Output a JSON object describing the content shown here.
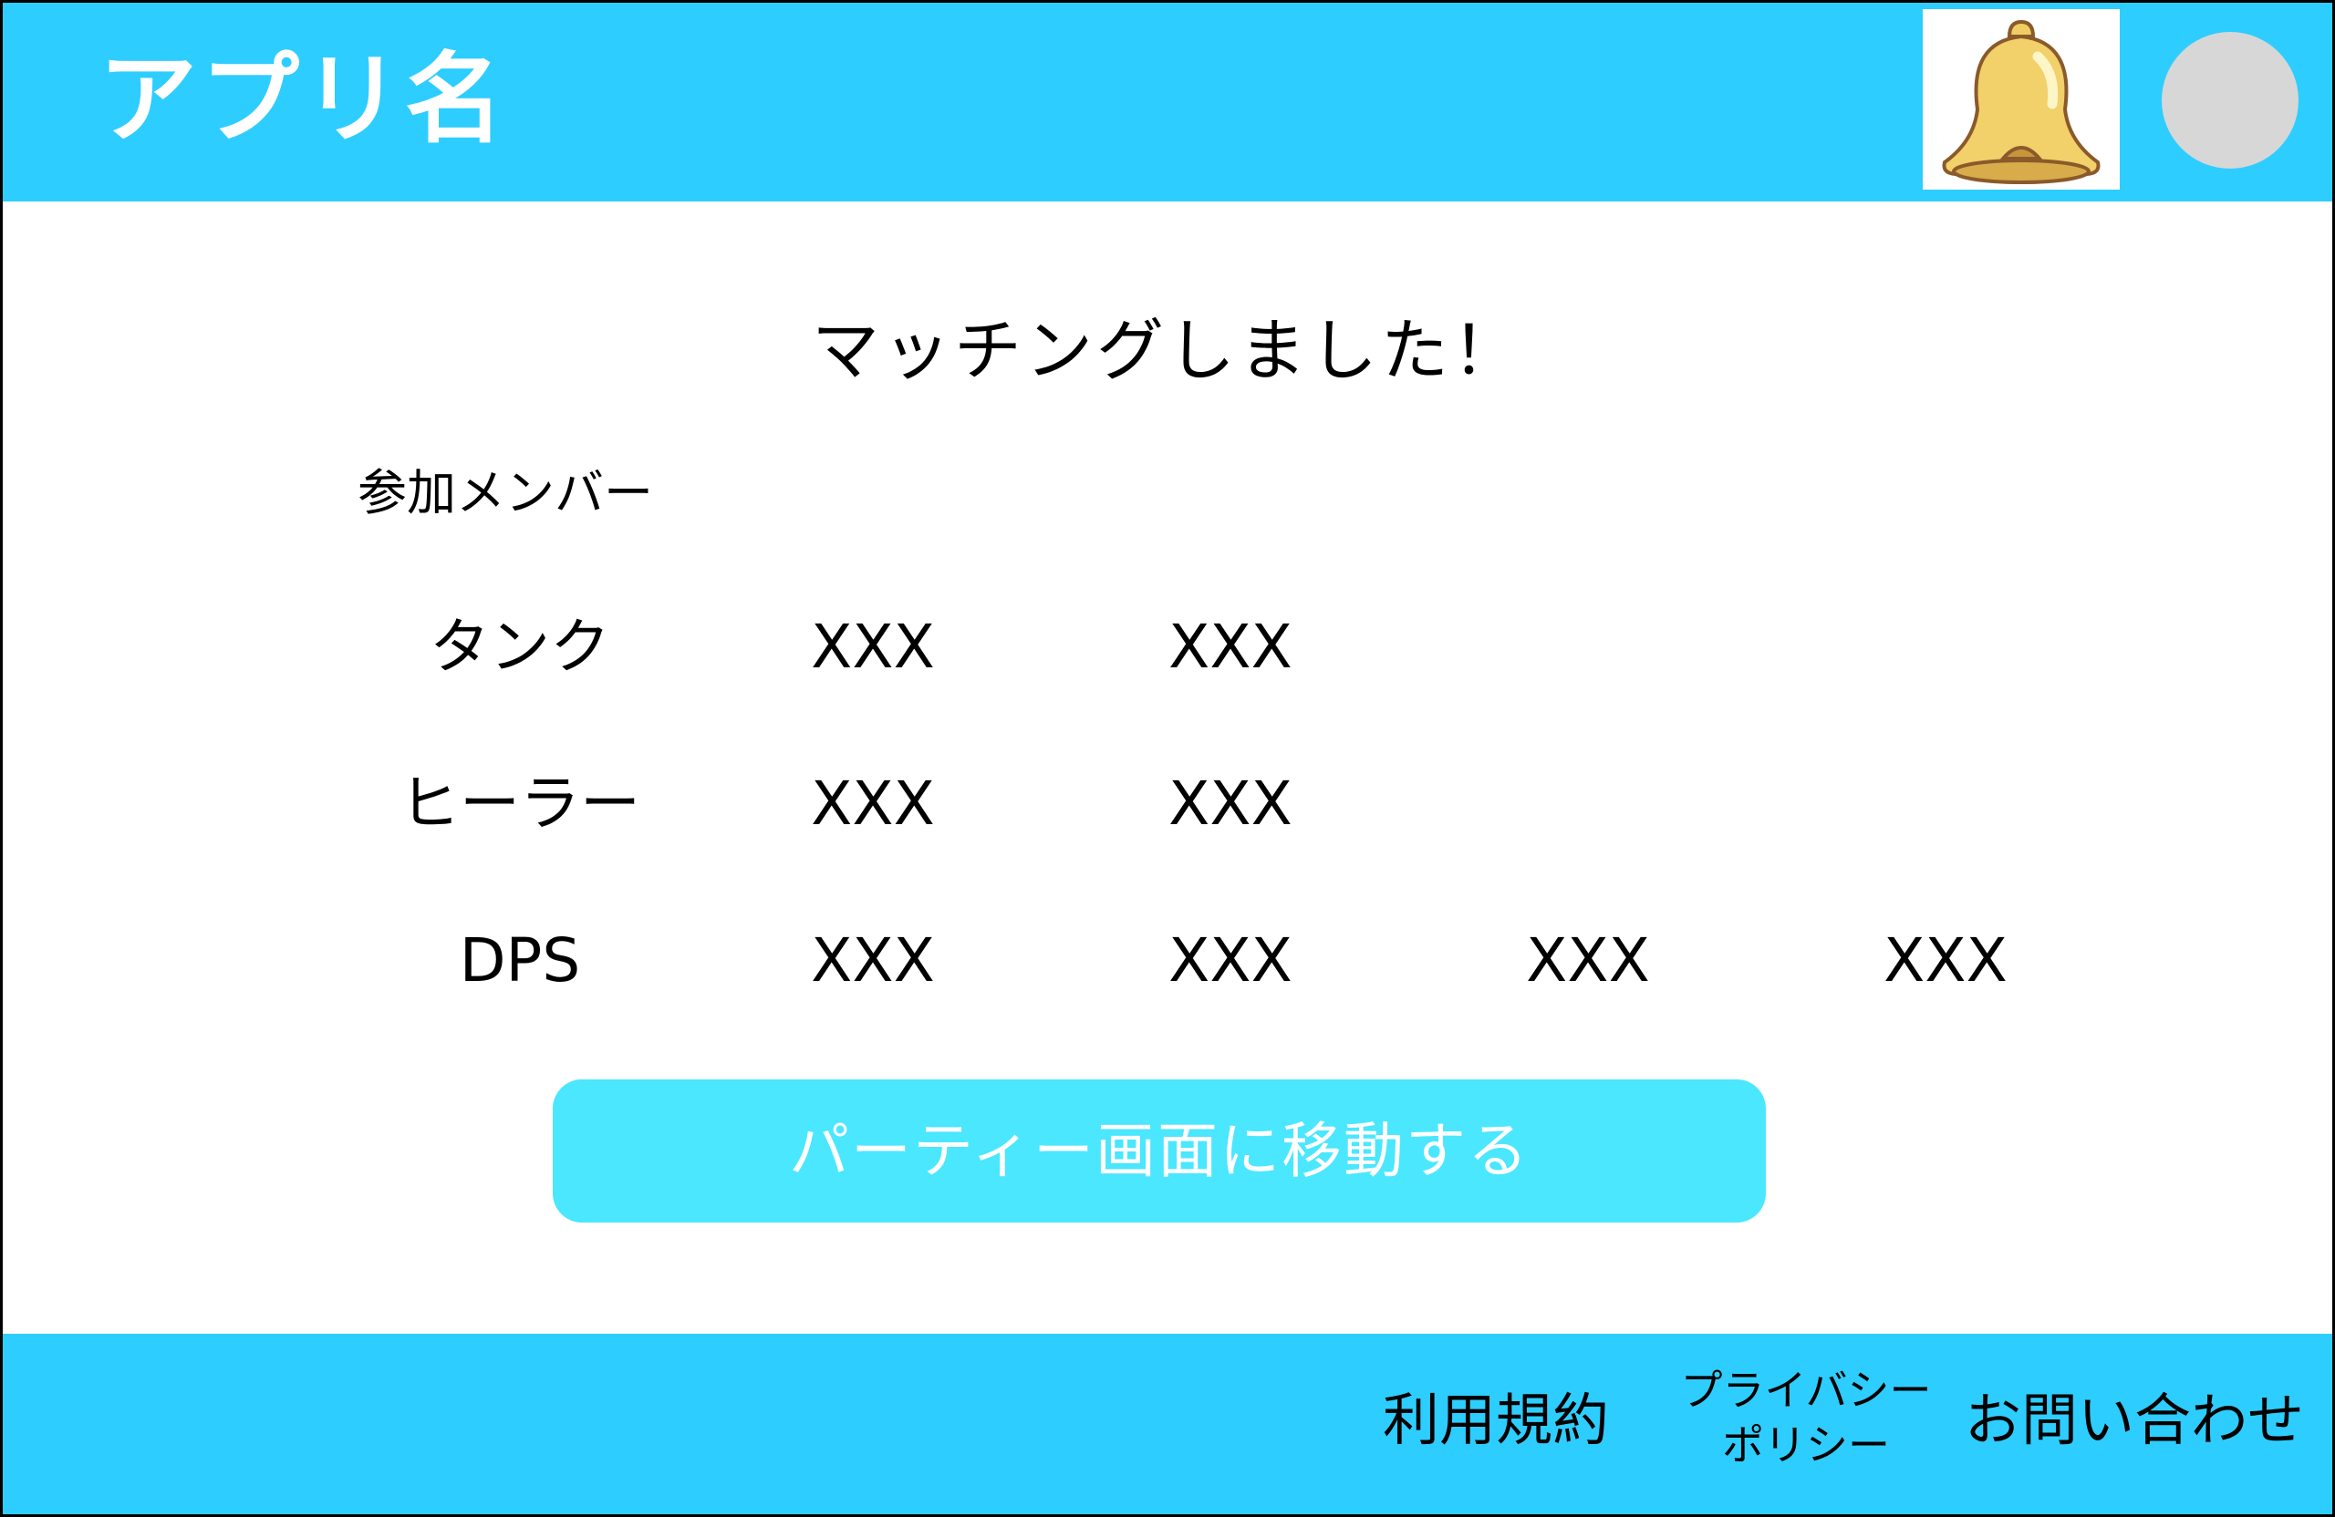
{
  "header": {
    "app_name": "アプリ名",
    "bell_icon": "bell-icon",
    "avatar_icon": "user-avatar",
    "background_color": "#2ecdff"
  },
  "main": {
    "heading": "マッチングしました！",
    "members_label": "参加メンバー",
    "roles": [
      {
        "name": "タンク",
        "members": [
          "XXX",
          "XXX"
        ]
      },
      {
        "name": "ヒーラー",
        "members": [
          "XXX",
          "XXX"
        ]
      },
      {
        "name": "DPS",
        "members": [
          "XXX",
          "XXX",
          "XXX",
          "XXX"
        ]
      }
    ],
    "party_button_label": "パーティー画面に移動する",
    "button_color": "#4ae7ff"
  },
  "footer": {
    "terms": "利用規約",
    "privacy_line1": "プライバシー",
    "privacy_line2": "ポリシー",
    "contact": "お問い合わせ"
  }
}
